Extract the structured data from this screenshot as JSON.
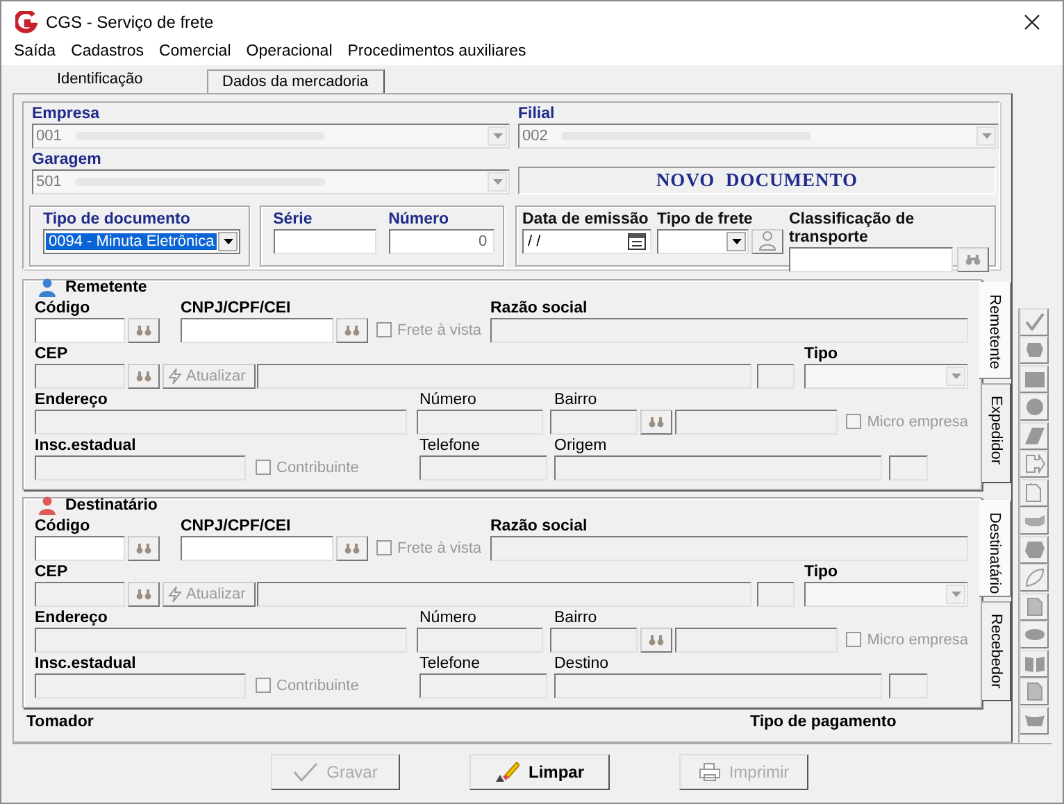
{
  "window": {
    "title": "CGS - Serviço de frete"
  },
  "menu": [
    "Saída",
    "Cadastros",
    "Comercial",
    "Operacional",
    "Procedimentos auxiliares"
  ],
  "tabs": [
    {
      "label": "Identificação",
      "selected": true
    },
    {
      "label": "Dados da mercadoria",
      "selected": false
    }
  ],
  "header": {
    "empresa": {
      "label": "Empresa",
      "value": "001"
    },
    "filial": {
      "label": "Filial",
      "value": "002"
    },
    "garagem": {
      "label": "Garagem",
      "value": "501"
    },
    "status": "NOVO DOCUMENTO",
    "tipo_documento": {
      "label": "Tipo de documento",
      "value": "0094 - Minuta Eletrônica"
    },
    "serie": {
      "label": "Série"
    },
    "numero": {
      "label": "Número",
      "value": "0"
    },
    "data_emissao": {
      "label": "Data de emissão",
      "value": "/ /"
    },
    "tipo_frete": {
      "label": "Tipo de frete"
    },
    "classificacao": {
      "label": "Classificação de transporte"
    }
  },
  "parties": [
    {
      "title": "Remetente",
      "kind": "sender",
      "labels": {
        "codigo": "Código",
        "cnpj": "CNPJ/CPF/CEI",
        "razao": "Razão social",
        "cep": "CEP",
        "tipo": "Tipo",
        "endereco": "Endereço",
        "numero": "Número",
        "bairro": "Bairro",
        "insc": "Insc.estadual",
        "telefone": "Telefone",
        "local": "Origem"
      },
      "frete_a_vista": {
        "label": "Frete à vista",
        "checked": false,
        "disabled": true
      },
      "atualizar": {
        "label": "Atualizar",
        "disabled": true
      },
      "micro_empresa": {
        "label": "Micro empresa",
        "checked": false,
        "disabled": true
      },
      "contribuinte": {
        "label": "Contribuinte",
        "checked": false,
        "disabled": true
      },
      "side_tabs": [
        {
          "label": "Remetente",
          "selected": true
        },
        {
          "label": "Expedidor",
          "selected": false
        }
      ]
    },
    {
      "title": "Destinatário",
      "kind": "recipient",
      "labels": {
        "codigo": "Código",
        "cnpj": "CNPJ/CPF/CEI",
        "razao": "Razão social",
        "cep": "CEP",
        "tipo": "Tipo",
        "endereco": "Endereço",
        "numero": "Número",
        "bairro": "Bairro",
        "insc": "Insc.estadual",
        "telefone": "Telefone",
        "local": "Destino"
      },
      "frete_a_vista": {
        "label": "Frete à vista",
        "checked": false,
        "disabled": true
      },
      "atualizar": {
        "label": "Atualizar",
        "disabled": true
      },
      "micro_empresa": {
        "label": "Micro empresa",
        "checked": false,
        "disabled": true
      },
      "contribuinte": {
        "label": "Contribuinte",
        "checked": false,
        "disabled": true
      },
      "side_tabs": [
        {
          "label": "Destinatário",
          "selected": true
        },
        {
          "label": "Recebedor",
          "selected": false
        }
      ]
    }
  ],
  "footer": {
    "tomador": "Tomador",
    "tipo_pagamento": "Tipo de pagamento"
  },
  "buttons": [
    {
      "label": "Gravar",
      "kind": "save",
      "disabled": true
    },
    {
      "label": "Limpar",
      "kind": "clear",
      "disabled": false
    },
    {
      "label": "Imprimir",
      "kind": "print",
      "disabled": true
    }
  ]
}
